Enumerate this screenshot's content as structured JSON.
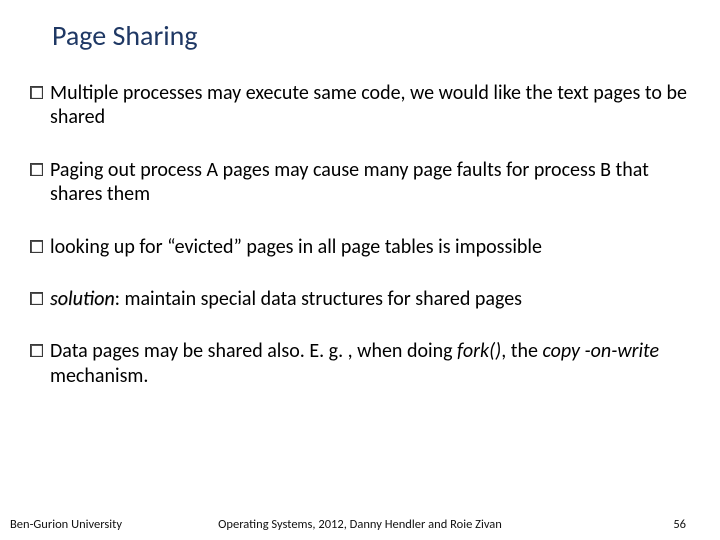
{
  "title": "Page Sharing",
  "bullets": {
    "b1": "Multiple processes may execute same code, we would like the text pages to be shared",
    "b2": "Paging out process A pages may cause many page faults for process B that shares them",
    "b3": "looking up for “evicted” pages in all page tables is impossible",
    "b4_solution": "solution",
    "b4_rest": ": maintain special data structures for shared pages",
    "b5_pre": "Data pages may be shared also. E. g. , when doing ",
    "b5_fork": "fork()",
    "b5_mid": ", the ",
    "b5_cow": "copy -on-write",
    "b5_post": " mechanism."
  },
  "footer": {
    "left": "Ben-Gurion University",
    "center": "Operating Systems, 2012, Danny Hendler and Roie Zivan",
    "pagenum": "56"
  }
}
